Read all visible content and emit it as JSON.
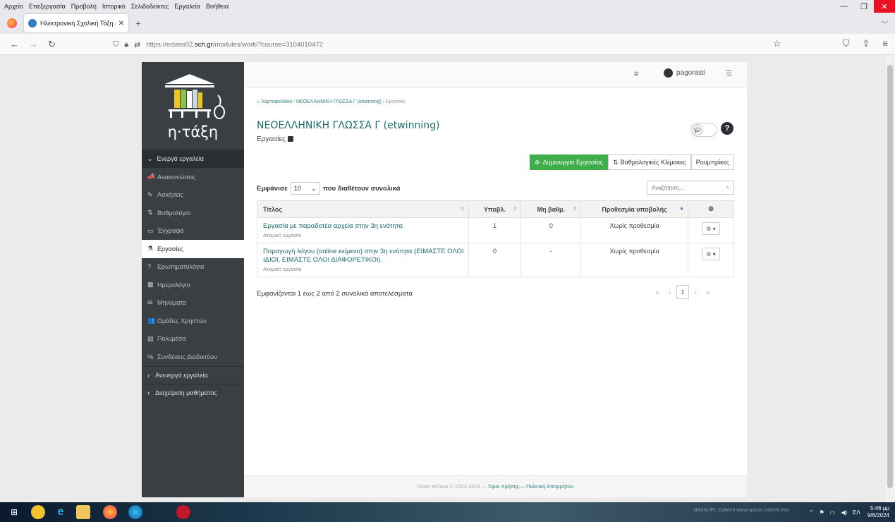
{
  "menubar": [
    "Αρχείο",
    "Επεξεργασία",
    "Προβολή",
    "Ιστορικό",
    "Σελιδοδείκτες",
    "Εργαλεία",
    "Βοήθεια"
  ],
  "window": {
    "minimize": "—",
    "maximize": "❐",
    "close": "✕"
  },
  "tab": {
    "title": "Ηλεκτρονική Σχολική Τάξη (η-",
    "close": "✕",
    "new": "+"
  },
  "address": {
    "prefix": "https://eclass02.",
    "domain": "sch.gr",
    "suffix": "/modules/work/?course=3104010472"
  },
  "sidebar": {
    "brand": "η·τάξη",
    "active_tools_header": "Ενεργά εργαλεία",
    "items": [
      {
        "icon": "megaphone-icon",
        "glyph": "📣",
        "label": "Ανακοινώσεις"
      },
      {
        "icon": "edit-icon",
        "glyph": "✎",
        "label": "Ασκήσεις"
      },
      {
        "icon": "sort-numeric-icon",
        "glyph": "⇅",
        "label": "Βαθμολόγιο"
      },
      {
        "icon": "folder-icon",
        "glyph": "▭",
        "label": "Έγγραφα"
      },
      {
        "icon": "flask-icon",
        "glyph": "⚗",
        "label": "Εργασίες"
      },
      {
        "icon": "question-circle-icon",
        "glyph": "?",
        "label": "Ερωτηματολόγια"
      },
      {
        "icon": "calendar-icon",
        "glyph": "▦",
        "label": "Ημερολόγιο"
      },
      {
        "icon": "envelope-icon",
        "glyph": "✉",
        "label": "Μηνύματα"
      },
      {
        "icon": "users-icon",
        "glyph": "👥",
        "label": "Ομάδες Χρηστών"
      },
      {
        "icon": "film-icon",
        "glyph": "▤",
        "label": "Πολυμέσα"
      },
      {
        "icon": "link-icon",
        "glyph": "%",
        "label": "Συνδέσεις Διαδικτύου"
      }
    ],
    "inactive_tools_header": "Ανενεργά εργαλεία",
    "course_admin_header": "Διαχείριση μαθήματος"
  },
  "topbar": {
    "username": "pagorasti"
  },
  "breadcrumb": {
    "home": "Χαρτοφυλάκιο",
    "course": "ΝΕΟΕΛΛΗΝΙΚΗ ΓΛΩΣΣΑ Γ (etwinning)",
    "current": "Εργασίες",
    "sep": "/"
  },
  "page": {
    "course_title": "ΝΕΟΕΛΛΗΝΙΚΗ ΓΛΩΣΣΑ Γ (etwinning)",
    "subtitle": "Εργασίες"
  },
  "actions": {
    "create": "Δημιουργία Εργασίας",
    "grading_scales": "Βαθμολογικές Κλίμακες",
    "rubrics": "Ρουμπρίκες"
  },
  "list_controls": {
    "show_prefix": "Εμφάνισε",
    "page_size": "10",
    "show_suffix": "που διαθέτουν συνολικά",
    "search_placeholder": "Αναζήτηση..."
  },
  "table": {
    "headers": [
      "Τίτλος",
      "Υποβλ.",
      "Μη βαθμ.",
      "Προθεσμία υποβολής"
    ],
    "rows": [
      {
        "title": "Εργασία με παραδοτέα αρχεία στην 3η ενότητα",
        "type": "Ατομική εργασία",
        "submitted": "1",
        "ungraded": "0",
        "deadline": "Χωρίς προθεσμία"
      },
      {
        "title": "Παραγωγή λόγου (online κείμενο) στην 3η ενότητα (ΕΙΜΑΣΤΕ ΟΛΟΙ ΙΔΙΟΙ, ΕΙΜΑΣΤΕ ΟΛΟΙ ΔΙΑΦΟΡΕΤΙΚΟΙ).",
        "type": "Ατομική εργασία",
        "submitted": "0",
        "ungraded": "-",
        "deadline": "Χωρίς προθεσμία"
      }
    ]
  },
  "summary": "Εμφανίζονται 1 έως 2 από 2 συνολικά αποτελέσματα",
  "pagination": {
    "first": "«",
    "prev": "‹",
    "current": "1",
    "next": "›",
    "last": "»"
  },
  "footer": {
    "copyright": "Open eClass © 2003-2024 — ",
    "terms": "Όροι Χρήσης",
    "sep": "— ",
    "privacy": "Πολιτική Απορρήτου"
  },
  "taskbar": {
    "watermark": "NASA/JPL-Caltech   www.spitzer.caltech.edu",
    "lang": "ΕΛ",
    "time": "5:46 μμ",
    "date": "9/6/2024"
  }
}
